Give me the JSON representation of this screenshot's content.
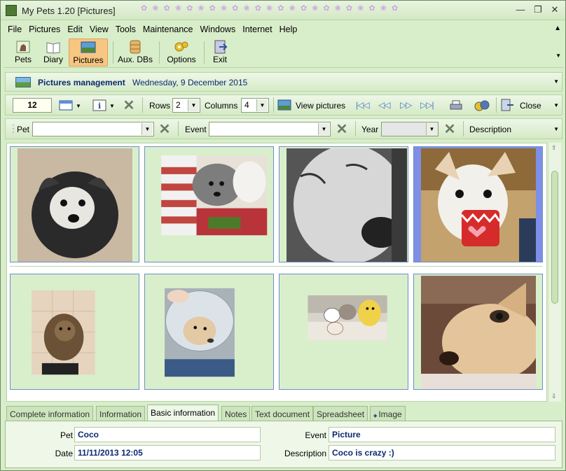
{
  "window": {
    "title": "My Pets 1.20  [Pictures]",
    "minimize": "—",
    "maximize": "❐",
    "close": "✕"
  },
  "menu": [
    "File",
    "Pictures",
    "Edit",
    "View",
    "Tools",
    "Maintenance",
    "Windows",
    "Internet",
    "Help"
  ],
  "toolbar": {
    "pets": "Pets",
    "diary": "Diary",
    "pictures": "Pictures",
    "aux_dbs": "Aux. DBs",
    "options": "Options",
    "exit": "Exit"
  },
  "header": {
    "title": "Pictures management",
    "date": "Wednesday, 9 December 2015"
  },
  "controls": {
    "count": "12",
    "rows_label": "Rows",
    "rows_value": "2",
    "columns_label": "Columns",
    "columns_value": "4",
    "view_pictures": "View pictures",
    "close": "Close"
  },
  "filters": {
    "pet_label": "Pet",
    "pet_value": "",
    "event_label": "Event",
    "event_value": "",
    "year_label": "Year",
    "year_value": "",
    "description_label": "Description"
  },
  "tabs": [
    "Complete information",
    "Information",
    "Basic information",
    "Notes",
    "Text document",
    "Spreadsheet",
    "Image"
  ],
  "active_tab": "Basic information",
  "details": {
    "pet_label": "Pet",
    "pet_value": "Coco",
    "date_label": "Date",
    "date_value": "11/11/2013 12:05",
    "event_label": "Event",
    "event_value": "Picture",
    "description_label": "Description",
    "description_value": "Coco is crazy  :)"
  },
  "colors": {
    "accent": "#0b2a6f",
    "active_toolbar": "#f6c682",
    "selected_cell": "#7d8fe6",
    "background": "#d8edc9"
  }
}
